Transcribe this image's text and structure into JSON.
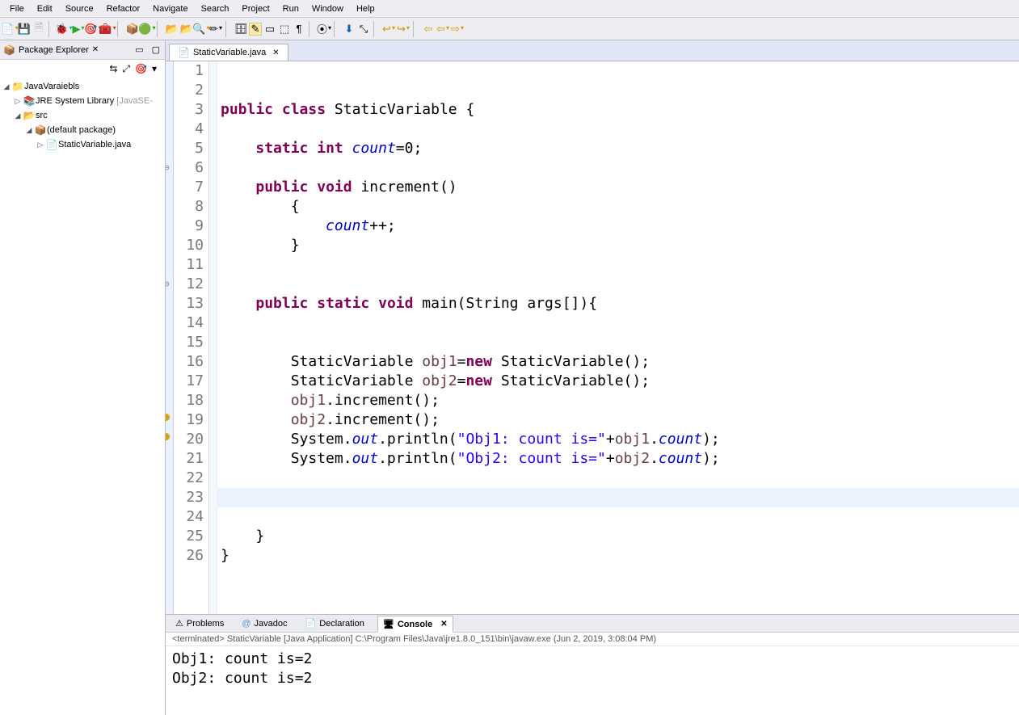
{
  "menubar": [
    "File",
    "Edit",
    "Source",
    "Refactor",
    "Navigate",
    "Search",
    "Project",
    "Run",
    "Window",
    "Help"
  ],
  "pkg_explorer": {
    "title": "Package Explorer",
    "project": "JavaVaraiebls",
    "lib": "JRE System Library",
    "lib_suffix": "[JavaSE-",
    "src": "src",
    "pkg": "(default package)",
    "file": "StaticVariable.java"
  },
  "editor": {
    "tab": "StaticVariable.java",
    "lines": [
      "1",
      "2",
      "3",
      "4",
      "5",
      "6",
      "7",
      "8",
      "9",
      "10",
      "11",
      "12",
      "13",
      "14",
      "15",
      "16",
      "17",
      "18",
      "19",
      "20",
      "21",
      "22",
      "23",
      "24",
      "25",
      "26"
    ],
    "code_tokens": {
      "l2a": "public",
      "l2b": "class",
      "l2c": " StaticVariable {",
      "l4a": "static",
      "l4b": "int",
      "l4c": "count",
      "l4d": "=0;",
      "l6a": "public",
      "l6b": "void",
      "l6c": " increment()",
      "l7": "{",
      "l8a": "count",
      "l8b": "++;",
      "l9": "}",
      "l12a": "public",
      "l12b": "static",
      "l12c": "void",
      "l12d": " main(String args[]){",
      "l15a": "StaticVariable ",
      "l15b": "obj1",
      "l15c": "=",
      "l15d": "new",
      "l15e": " StaticVariable();",
      "l16a": "StaticVariable ",
      "l16b": "obj2",
      "l16c": "=",
      "l16d": "new",
      "l16e": " StaticVariable();",
      "l17a": "obj1",
      "l17b": ".increment();",
      "l18a": "obj2",
      "l18b": ".increment();",
      "l19a": "System.",
      "l19b": "out",
      "l19c": ".println(",
      "l19d": "\"Obj1: count is=\"",
      "l19e": "+",
      "l19f": "obj1",
      "l19g": ".",
      "l19h": "count",
      "l19i": ");",
      "l20a": "System.",
      "l20b": "out",
      "l20c": ".println(",
      "l20d": "\"Obj2: count is=\"",
      "l20e": "+",
      "l20f": "obj2",
      "l20g": ".",
      "l20h": "count",
      "l20i": ");",
      "l24": "}",
      "l25": "}"
    }
  },
  "bottom": {
    "tabs": [
      "Problems",
      "Javadoc",
      "Declaration",
      "Console"
    ],
    "terminated": "<terminated> StaticVariable [Java Application] C:\\Program Files\\Java\\jre1.8.0_151\\bin\\javaw.exe (Jun 2, 2019, 3:08:04 PM)",
    "out1": "Obj1: count is=2",
    "out2": "Obj2: count is=2"
  }
}
